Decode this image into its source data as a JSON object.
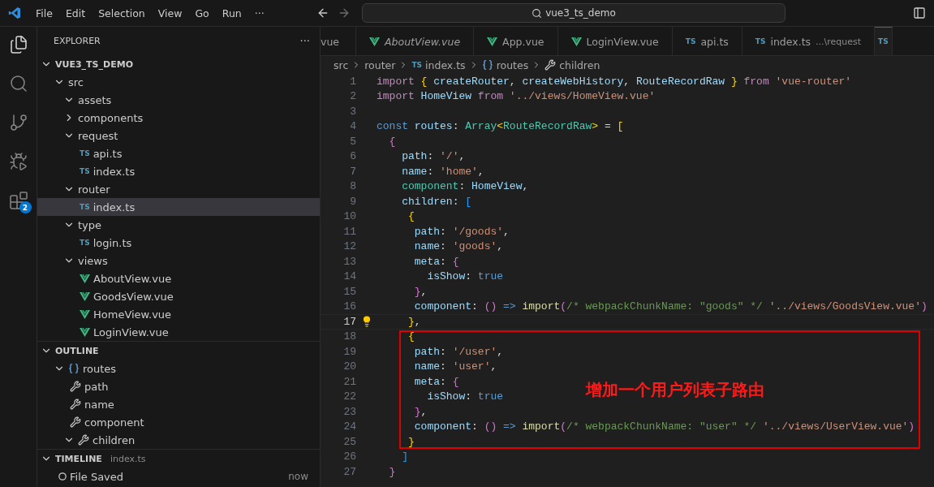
{
  "menu": [
    "File",
    "Edit",
    "Selection",
    "View",
    "Go",
    "Run",
    "···"
  ],
  "command_center": {
    "text": "vue3_ts_demo"
  },
  "activity_bar": [
    {
      "kind": "explorer",
      "selected": true
    },
    {
      "kind": "search",
      "selected": false
    },
    {
      "kind": "source-control",
      "selected": false
    },
    {
      "kind": "run-debug",
      "selected": false
    },
    {
      "kind": "extensions",
      "selected": false,
      "badge": "2"
    }
  ],
  "sidebar": {
    "title": "EXPLORER",
    "more": "···",
    "explorer": {
      "label": "VUE3_TS_DEMO",
      "expanded": true,
      "children": [
        {
          "label": "src",
          "expanded": true,
          "selected": false,
          "children": [
            {
              "label": "assets",
              "expanded": true,
              "selected": false
            },
            {
              "label": "components",
              "expanded": false,
              "selected": false
            },
            {
              "label": "request",
              "expanded": true,
              "selected": false,
              "children": [
                {
                  "label": "api.ts",
                  "kind": "ts",
                  "badge": "TS",
                  "selected": false
                },
                {
                  "label": "index.ts",
                  "kind": "ts",
                  "badge": "TS",
                  "selected": false
                }
              ]
            },
            {
              "label": "router",
              "expanded": true,
              "selected": false,
              "children": [
                {
                  "label": "index.ts",
                  "kind": "ts",
                  "badge": "TS",
                  "selected": true
                }
              ]
            },
            {
              "label": "type",
              "expanded": true,
              "selected": false,
              "children": [
                {
                  "label": "login.ts",
                  "kind": "ts",
                  "badge": "TS",
                  "selected": false
                }
              ]
            },
            {
              "label": "views",
              "expanded": true,
              "selected": false,
              "children": [
                {
                  "label": "AboutView.vue",
                  "kind": "vue",
                  "selected": false
                },
                {
                  "label": "GoodsView.vue",
                  "kind": "vue",
                  "selected": false
                },
                {
                  "label": "HomeView.vue",
                  "kind": "vue",
                  "selected": false
                },
                {
                  "label": "LoginView.vue",
                  "kind": "vue",
                  "selected": false
                }
              ]
            }
          ]
        }
      ]
    },
    "outline": {
      "label": "OUTLINE",
      "expanded": true,
      "children": [
        {
          "label": "routes",
          "kind": "variable",
          "expanded": true,
          "selected": false,
          "children": [
            {
              "label": "path",
              "kind": "property",
              "selected": false
            },
            {
              "label": "name",
              "kind": "property",
              "selected": false
            },
            {
              "label": "component",
              "kind": "property",
              "selected": false
            },
            {
              "label": "children",
              "kind": "property",
              "expanded": true,
              "selected": false
            }
          ]
        }
      ]
    },
    "timeline": {
      "label": "TIMELINE",
      "expanded": true,
      "file": "index.ts",
      "entries": [
        {
          "label": "File Saved",
          "time": "now"
        }
      ]
    }
  },
  "tabs": [
    {
      "label": "vue",
      "kind": "cut",
      "selected": false
    },
    {
      "label": "AboutView.vue",
      "kind": "vue",
      "italic": true,
      "selected": false
    },
    {
      "label": "App.vue",
      "kind": "vue",
      "italic": false,
      "selected": false
    },
    {
      "label": "LoginView.vue",
      "kind": "vue",
      "italic": false,
      "selected": false
    },
    {
      "label": "api.ts",
      "kind": "ts",
      "badge": "TS",
      "italic": false,
      "selected": false
    },
    {
      "label": "index.ts",
      "kind": "ts",
      "badge": "TS",
      "italic": false,
      "selected": false,
      "description": "...\\request"
    },
    {
      "kind": "ts",
      "badge": "TS",
      "selected": true
    }
  ],
  "breadcrumb": [
    {
      "label": "src"
    },
    {
      "label": "router"
    },
    {
      "label": "index.ts",
      "kind": "ts",
      "badge": "TS"
    },
    {
      "label": "routes",
      "kind": "variable"
    },
    {
      "label": "children",
      "kind": "property"
    }
  ],
  "code": [
    {
      "number": "1",
      "current": false,
      "tokens": [
        {
          "text": "import",
          "kind": "kw"
        },
        {
          "text": " {",
          "kind": "b1"
        },
        {
          "text": " createRouter",
          "kind": "var"
        },
        {
          "text": ", ",
          "kind": "p"
        },
        {
          "text": "createWebHistory",
          "kind": "var"
        },
        {
          "text": ", ",
          "kind": "p"
        },
        {
          "text": "RouteRecordRaw",
          "kind": "var"
        },
        {
          "text": " }",
          "kind": "b1"
        },
        {
          "text": " from",
          "kind": "kw"
        },
        {
          "text": " 'vue-router'",
          "kind": "str"
        }
      ]
    },
    {
      "number": "2",
      "current": false,
      "tokens": [
        {
          "text": "import",
          "kind": "kw"
        },
        {
          "text": " HomeView",
          "kind": "var"
        },
        {
          "text": " from",
          "kind": "kw"
        },
        {
          "text": " '../views/HomeView.vue'",
          "kind": "str"
        }
      ]
    },
    {
      "number": "3",
      "current": false
    },
    {
      "number": "4",
      "current": false,
      "tokens": [
        {
          "text": "const",
          "kind": "storage"
        },
        {
          "text": " routes",
          "kind": "var"
        },
        {
          "text": ": ",
          "kind": "p"
        },
        {
          "text": "Array",
          "kind": "type"
        },
        {
          "text": "<",
          "kind": "b1"
        },
        {
          "text": "RouteRecordRaw",
          "kind": "type"
        },
        {
          "text": ">",
          "kind": "b1"
        },
        {
          "text": " = ",
          "kind": "p"
        },
        {
          "text": "[",
          "kind": "b1"
        }
      ]
    },
    {
      "number": "5",
      "current": false,
      "tokens": [
        {
          "text": "  {",
          "kind": "b2"
        }
      ]
    },
    {
      "number": "6",
      "current": false,
      "tokens": [
        {
          "text": "    path",
          "kind": "var"
        },
        {
          "text": ": ",
          "kind": "p"
        },
        {
          "text": "'/'",
          "kind": "str"
        },
        {
          "text": ",",
          "kind": "p"
        }
      ]
    },
    {
      "number": "7",
      "current": false,
      "tokens": [
        {
          "text": "    name",
          "kind": "var"
        },
        {
          "text": ": ",
          "kind": "p"
        },
        {
          "text": "'home'",
          "kind": "str"
        },
        {
          "text": ",",
          "kind": "p"
        }
      ]
    },
    {
      "number": "8",
      "current": false,
      "tokens": [
        {
          "text": "    component",
          "kind": "type"
        },
        {
          "text": ": ",
          "kind": "p"
        },
        {
          "text": "HomeView",
          "kind": "var"
        },
        {
          "text": ",",
          "kind": "p"
        }
      ]
    },
    {
      "number": "9",
      "current": false,
      "tokens": [
        {
          "text": "    children",
          "kind": "var"
        },
        {
          "text": ": ",
          "kind": "p"
        },
        {
          "text": "[",
          "kind": "b3"
        }
      ]
    },
    {
      "number": "10",
      "current": false,
      "tokens": [
        {
          "text": "     {",
          "kind": "b1"
        }
      ]
    },
    {
      "number": "11",
      "current": false,
      "tokens": [
        {
          "text": "      path",
          "kind": "var"
        },
        {
          "text": ": ",
          "kind": "p"
        },
        {
          "text": "'/goods'",
          "kind": "str"
        },
        {
          "text": ",",
          "kind": "p"
        }
      ]
    },
    {
      "number": "12",
      "current": false,
      "tokens": [
        {
          "text": "      name",
          "kind": "var"
        },
        {
          "text": ": ",
          "kind": "p"
        },
        {
          "text": "'goods'",
          "kind": "str"
        },
        {
          "text": ",",
          "kind": "p"
        }
      ]
    },
    {
      "number": "13",
      "current": false,
      "tokens": [
        {
          "text": "      meta",
          "kind": "var"
        },
        {
          "text": ": ",
          "kind": "p"
        },
        {
          "text": "{",
          "kind": "b2"
        }
      ]
    },
    {
      "number": "14",
      "current": false,
      "tokens": [
        {
          "text": "        isShow",
          "kind": "var"
        },
        {
          "text": ": ",
          "kind": "p"
        },
        {
          "text": "true",
          "kind": "storage"
        }
      ]
    },
    {
      "number": "15",
      "current": false,
      "tokens": [
        {
          "text": "      }",
          "kind": "b2"
        },
        {
          "text": ",",
          "kind": "p"
        }
      ]
    },
    {
      "number": "16",
      "current": false,
      "tokens": [
        {
          "text": "      component",
          "kind": "var"
        },
        {
          "text": ": ",
          "kind": "p"
        },
        {
          "text": "()",
          "kind": "b2"
        },
        {
          "text": " =>",
          "kind": "storage"
        },
        {
          "text": " import",
          "kind": "fn"
        },
        {
          "text": "(",
          "kind": "b2"
        },
        {
          "text": "/* webpackChunkName: \"goods\" */",
          "kind": "cmt"
        },
        {
          "text": " '../views/GoodsView.vue'",
          "kind": "str"
        },
        {
          "text": ")",
          "kind": "b2"
        }
      ]
    },
    {
      "number": "17",
      "current": true,
      "tokens": [
        {
          "text": "     }",
          "kind": "b1"
        },
        {
          "text": ",",
          "kind": "p"
        }
      ]
    },
    {
      "number": "18",
      "current": false,
      "tokens": [
        {
          "text": "     {",
          "kind": "b1"
        }
      ]
    },
    {
      "number": "19",
      "current": false,
      "tokens": [
        {
          "text": "      path",
          "kind": "var"
        },
        {
          "text": ": ",
          "kind": "p"
        },
        {
          "text": "'/user'",
          "kind": "str"
        },
        {
          "text": ",",
          "kind": "p"
        }
      ]
    },
    {
      "number": "20",
      "current": false,
      "tokens": [
        {
          "text": "      name",
          "kind": "var"
        },
        {
          "text": ": ",
          "kind": "p"
        },
        {
          "text": "'user'",
          "kind": "str"
        },
        {
          "text": ",",
          "kind": "p"
        }
      ]
    },
    {
      "number": "21",
      "current": false,
      "tokens": [
        {
          "text": "      meta",
          "kind": "var"
        },
        {
          "text": ": ",
          "kind": "p"
        },
        {
          "text": "{",
          "kind": "b2"
        }
      ]
    },
    {
      "number": "22",
      "current": false,
      "tokens": [
        {
          "text": "        isShow",
          "kind": "var"
        },
        {
          "text": ": ",
          "kind": "p"
        },
        {
          "text": "true",
          "kind": "storage"
        }
      ]
    },
    {
      "number": "23",
      "current": false,
      "tokens": [
        {
          "text": "      }",
          "kind": "b2"
        },
        {
          "text": ",",
          "kind": "p"
        }
      ]
    },
    {
      "number": "24",
      "current": false,
      "tokens": [
        {
          "text": "      component",
          "kind": "var"
        },
        {
          "text": ": ",
          "kind": "p"
        },
        {
          "text": "()",
          "kind": "b2"
        },
        {
          "text": " =>",
          "kind": "storage"
        },
        {
          "text": " import",
          "kind": "fn"
        },
        {
          "text": "(",
          "kind": "b2"
        },
        {
          "text": "/* webpackChunkName: \"user\" */",
          "kind": "cmt"
        },
        {
          "text": " '../views/UserView.vue'",
          "kind": "str"
        },
        {
          "text": ")",
          "kind": "b2"
        }
      ]
    },
    {
      "number": "25",
      "current": false,
      "tokens": [
        {
          "text": "     }",
          "kind": "b1"
        }
      ]
    },
    {
      "number": "26",
      "current": false,
      "tokens": [
        {
          "text": "    ]",
          "kind": "b3"
        }
      ]
    },
    {
      "number": "27",
      "current": false,
      "tokens": [
        {
          "text": "  }",
          "kind": "b2"
        }
      ]
    }
  ],
  "annotation": {
    "text": "增加一个用户列表子路由"
  }
}
